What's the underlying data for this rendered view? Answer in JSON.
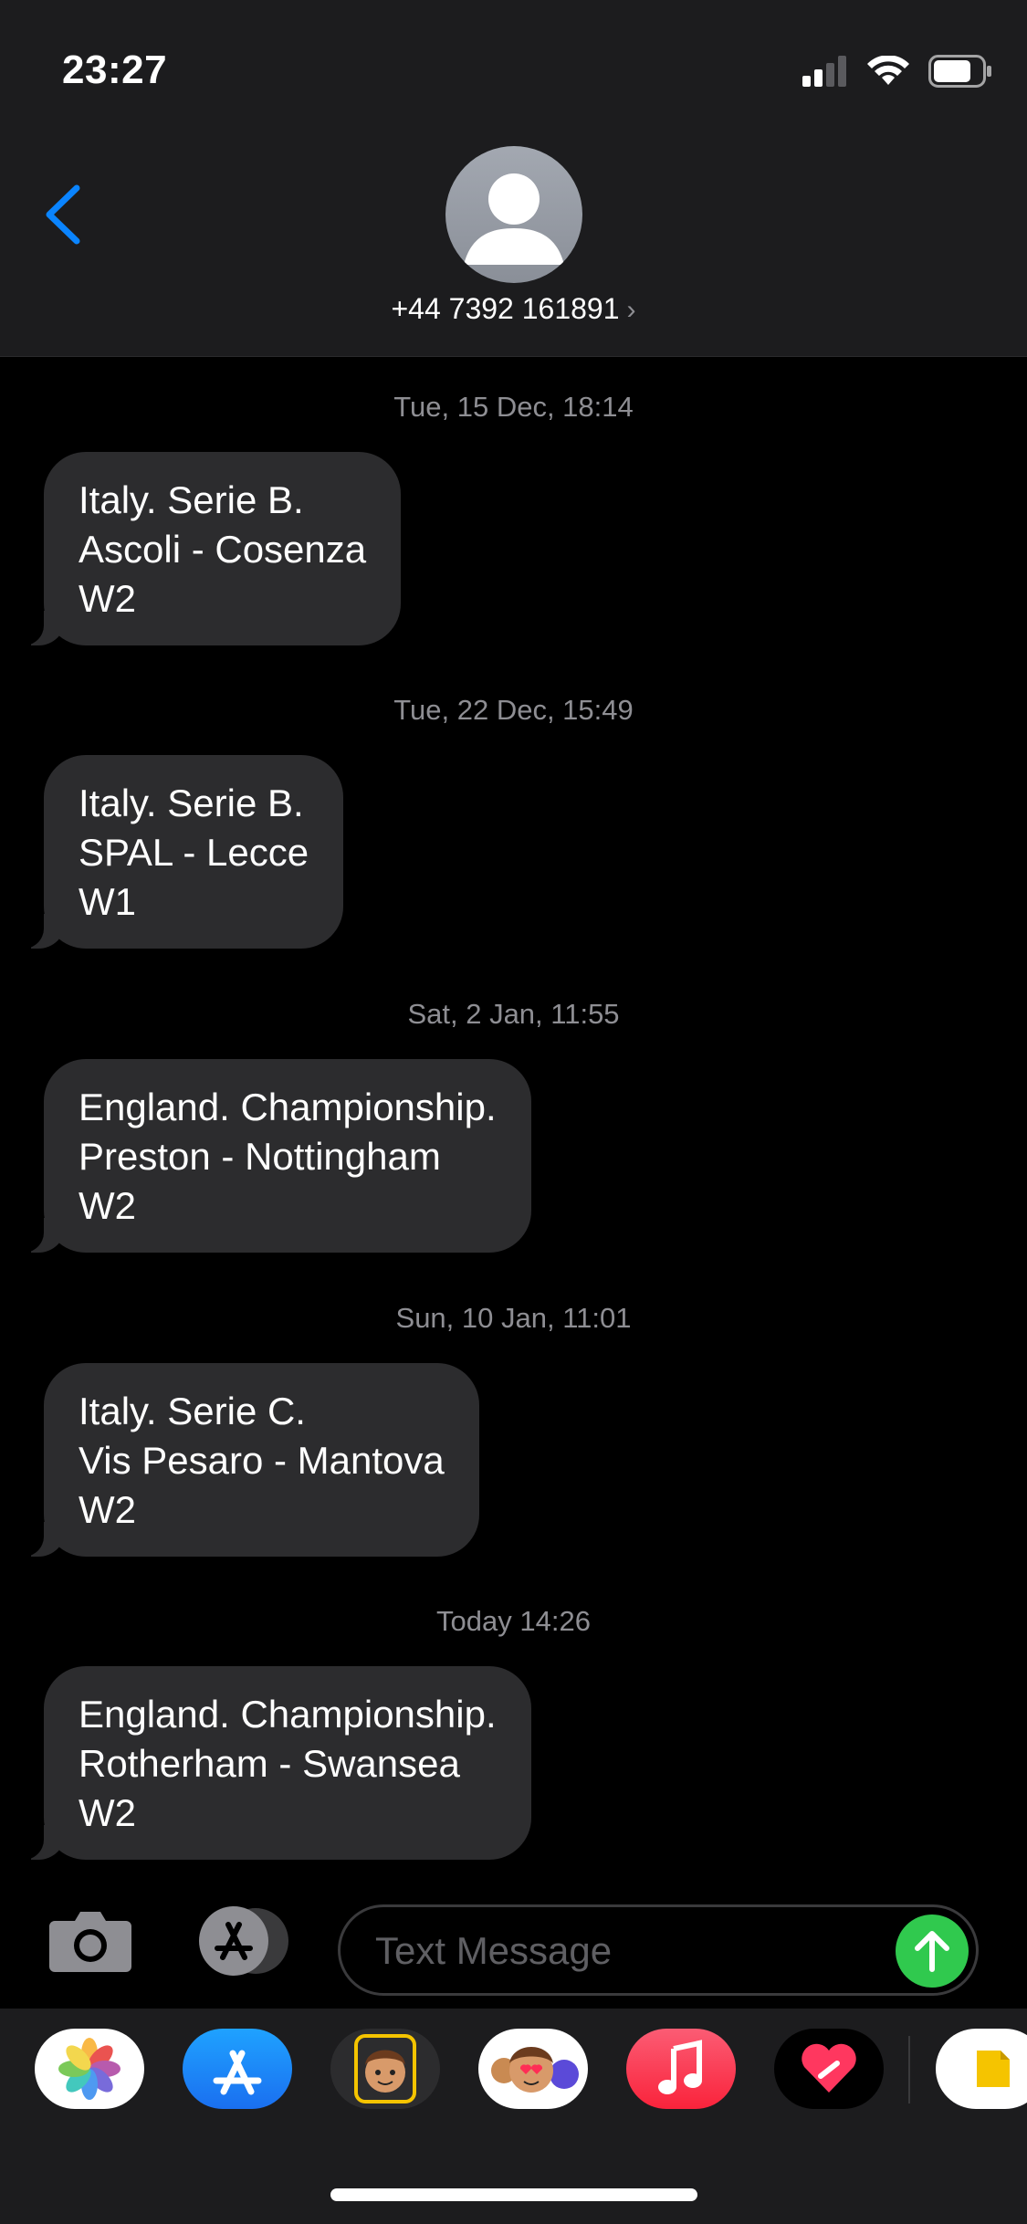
{
  "status_bar": {
    "time": "23:27"
  },
  "header": {
    "contact": "+44 7392 161891",
    "chevron": "›"
  },
  "messages": [
    {
      "timestamp": "Tue, 15 Dec, 18:14",
      "lines": [
        "Italy. Serie B.",
        "Ascoli - Cosenza",
        "W2"
      ]
    },
    {
      "timestamp": "Tue, 22 Dec, 15:49",
      "lines": [
        "Italy. Serie B.",
        "SPAL - Lecce",
        "W1"
      ]
    },
    {
      "timestamp": "Sat, 2 Jan, 11:55",
      "lines": [
        "England. Championship.",
        "Preston - Nottingham",
        "W2"
      ]
    },
    {
      "timestamp": "Sun, 10 Jan, 11:01",
      "lines": [
        "Italy. Serie C.",
        "Vis Pesaro - Mantova",
        "W2"
      ]
    },
    {
      "timestamp": "Today 14:26",
      "lines": [
        "England. Championship.",
        "Rotherham - Swansea",
        "W2"
      ]
    }
  ],
  "composer": {
    "placeholder": "Text Message"
  },
  "colors": {
    "bubble": "#2c2c2e",
    "accent": "#0a84ff",
    "send": "#30c94e"
  },
  "apps": [
    "photos-icon",
    "app-store-icon",
    "memoji-icon",
    "memoji-stickers-icon",
    "music-icon",
    "digital-touch-icon",
    "sticker-app-icon"
  ]
}
